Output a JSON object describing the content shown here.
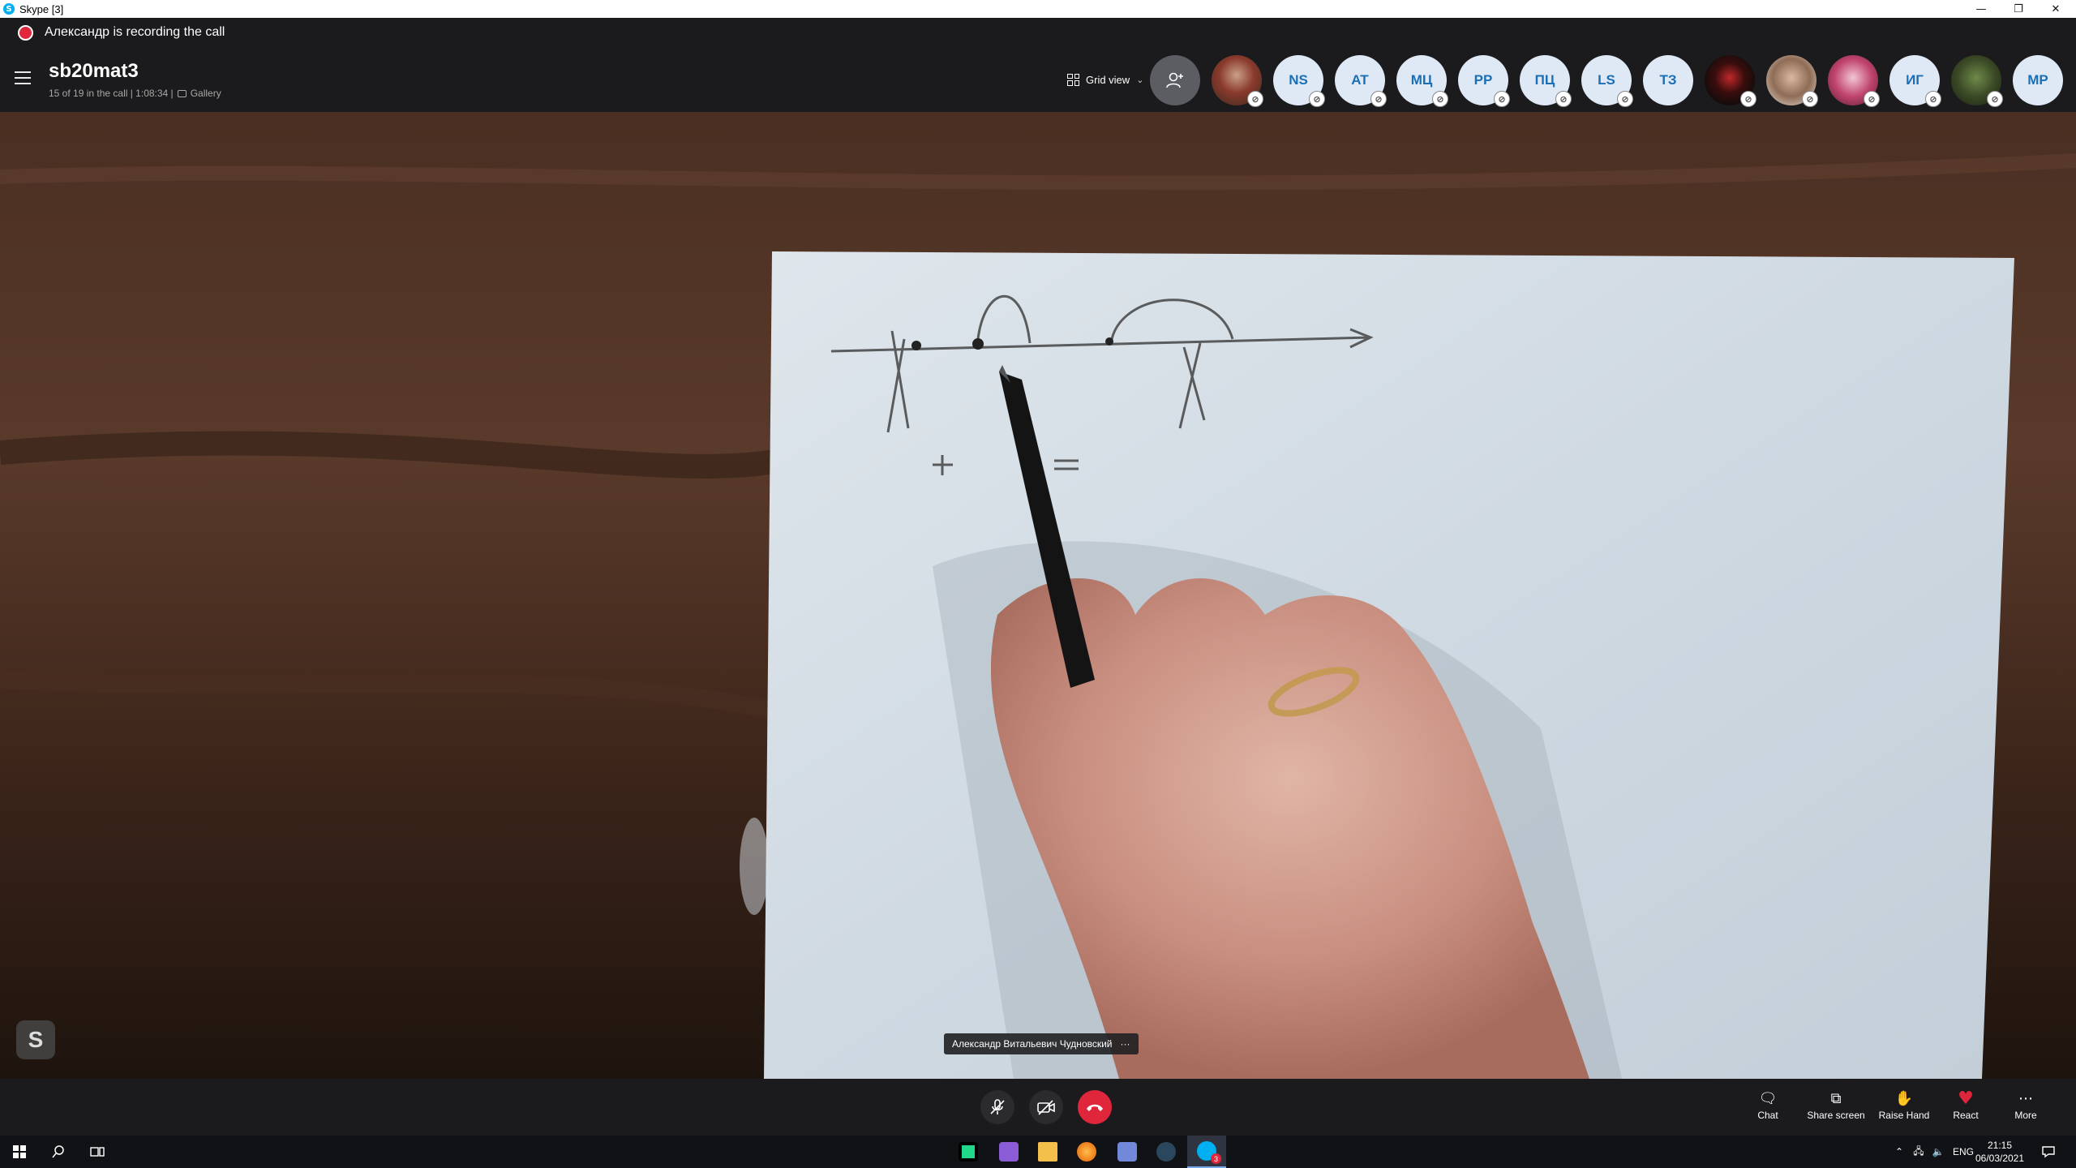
{
  "window": {
    "title": "Skype [3]",
    "minimize": "—",
    "restore": "❐",
    "close": "✕"
  },
  "recording": {
    "text": "Александр is recording the call"
  },
  "call": {
    "title": "sb20mat3",
    "subtitle": "15 of 19 in the call | 1:08:34 |",
    "gallery_label": "Gallery"
  },
  "view": {
    "label": "Grid view"
  },
  "participants": [
    "NS",
    "AT",
    "МЦ",
    "PP",
    "ПЦ",
    "LS",
    "ТЗ",
    "ИГ",
    "MP"
  ],
  "video": {
    "speaker_name": "Александр Витальевич Чудновский",
    "more_icon": "···",
    "badge": "S"
  },
  "controls": {
    "chat": "Chat",
    "share": "Share screen",
    "raise": "Raise Hand",
    "react": "React",
    "more": "More"
  },
  "taskbar": {
    "lang": "ENG",
    "time": "21:15",
    "date": "06/03/2021",
    "skype_badge": "3"
  },
  "colors": {
    "end_call": "#e0263b",
    "react_heart": "#e0263b",
    "avatar_bg": "#dfe9f6",
    "avatar_text": "#1b6fb5",
    "bar_bg": "#1b1b1d"
  }
}
